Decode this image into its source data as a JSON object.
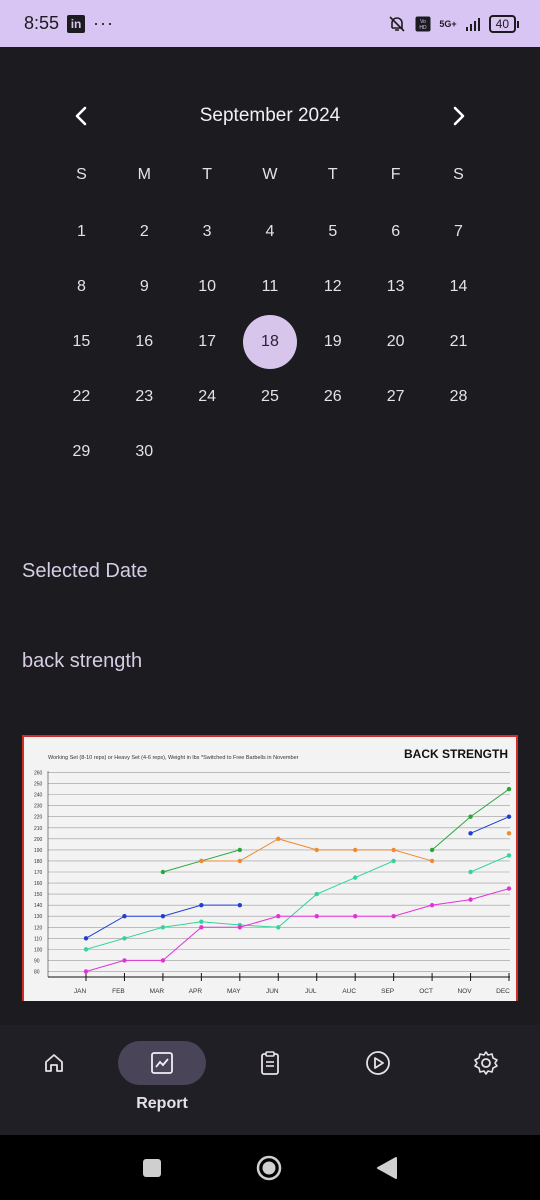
{
  "status_bar": {
    "time": "8:55",
    "app_icon": "in",
    "more": "···",
    "battery": "40",
    "net_label": "5G+"
  },
  "calendar": {
    "month_title": "September 2024",
    "weekdays": [
      "S",
      "M",
      "T",
      "W",
      "T",
      "F",
      "S"
    ],
    "days": [
      "1",
      "2",
      "3",
      "4",
      "5",
      "6",
      "7",
      "8",
      "9",
      "10",
      "11",
      "12",
      "13",
      "14",
      "15",
      "16",
      "17",
      "18",
      "19",
      "20",
      "21",
      "22",
      "23",
      "24",
      "25",
      "26",
      "27",
      "28",
      "29",
      "30"
    ],
    "selected_day": "18",
    "first_weekday_index": 0
  },
  "main": {
    "selected_label": "Selected Date",
    "workout_name": "back strength"
  },
  "chart_data": {
    "type": "line",
    "title": "BACK STRENGTH",
    "subtitle": "Working Set (8-10 reps) or Heavy Set (4-6 reps), Weight in lbs   *Switched to Free Barbells in November",
    "categories": [
      "JAN",
      "FEB",
      "MAR",
      "APR",
      "MAY",
      "JUN",
      "JUL",
      "AUC",
      "SEP",
      "OCT",
      "NOV",
      "DEC"
    ],
    "yticks": [
      80,
      90,
      100,
      110,
      120,
      130,
      140,
      150,
      160,
      170,
      180,
      190,
      200,
      210,
      220,
      230,
      240,
      250,
      260
    ],
    "ylim": [
      75,
      265
    ],
    "grid": true,
    "series": [
      {
        "color": "#1f3fd1",
        "values": [
          110,
          130,
          130,
          140,
          140,
          null,
          null,
          null,
          null,
          null,
          205,
          220
        ]
      },
      {
        "color": "#2aa63a",
        "values": [
          null,
          null,
          170,
          180,
          190,
          null,
          null,
          null,
          null,
          190,
          220,
          245
        ]
      },
      {
        "color": "#f08a30",
        "values": [
          null,
          null,
          null,
          180,
          180,
          200,
          190,
          190,
          190,
          180,
          null,
          205
        ]
      },
      {
        "color": "#34d39a",
        "values": [
          100,
          110,
          120,
          125,
          122,
          120,
          150,
          165,
          180,
          null,
          170,
          185
        ]
      },
      {
        "color": "#e232d6",
        "values": [
          80,
          90,
          90,
          120,
          120,
          130,
          130,
          130,
          130,
          140,
          145,
          155
        ]
      }
    ]
  },
  "bottom_nav": {
    "items": [
      {
        "name": "home",
        "label": ""
      },
      {
        "name": "report",
        "label": "Report"
      },
      {
        "name": "clipboard",
        "label": ""
      },
      {
        "name": "play",
        "label": ""
      },
      {
        "name": "settings",
        "label": ""
      }
    ],
    "active": "report"
  },
  "icons": [
    "chevron-left-icon",
    "chevron-right-icon",
    "home-icon",
    "report-chart-icon",
    "clipboard-icon",
    "play-icon",
    "gear-icon",
    "stop-icon",
    "home-circle-icon",
    "back-triangle-icon"
  ]
}
